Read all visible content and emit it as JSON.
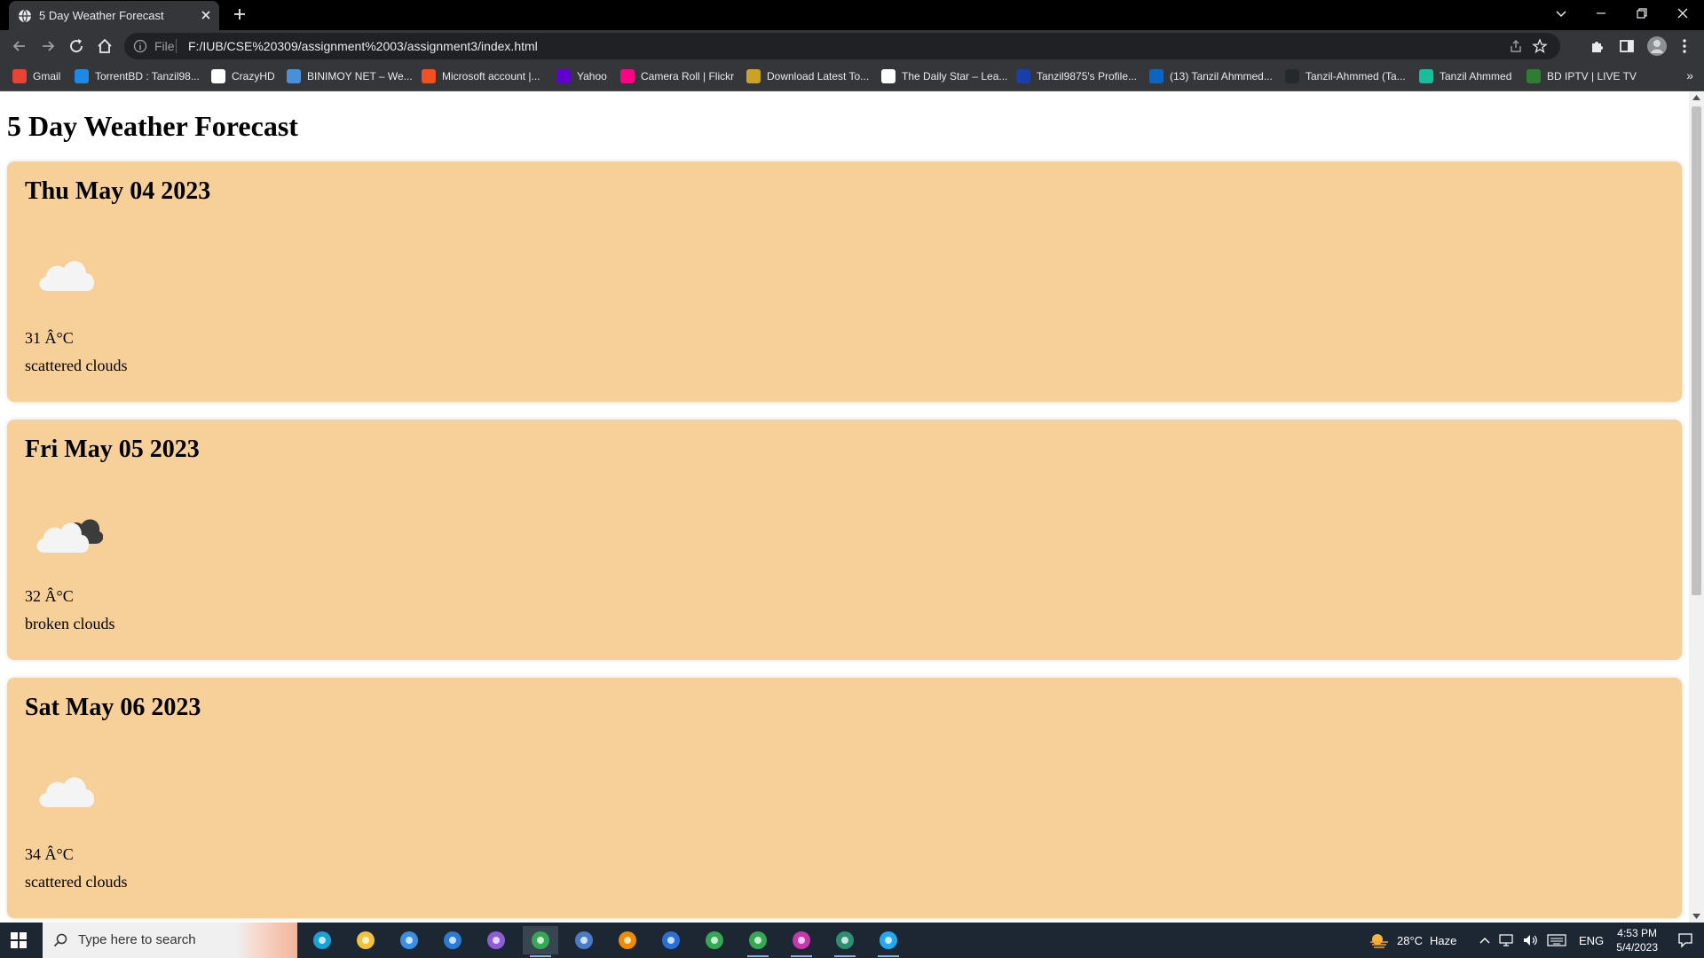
{
  "browser": {
    "tab_title": "5 Day Weather Forecast",
    "omnibox": {
      "scheme_label": "File",
      "url": "F:/IUB/CSE%20309/assignment%2003/assignment3/index.html"
    },
    "bookmarks": [
      {
        "label": "Gmail",
        "icon": "gmail-icon",
        "color": "#ea4335"
      },
      {
        "label": "TorrentBD : Tanzil98...",
        "icon": "torrentbd-icon",
        "color": "#1e88e5"
      },
      {
        "label": "CrazyHD",
        "icon": "crazyhd-icon",
        "color": "#ffffff"
      },
      {
        "label": "BINIMOY NET – We...",
        "icon": "binimoy-icon",
        "color": "#4a90d9"
      },
      {
        "label": "Microsoft account |...",
        "icon": "microsoft-icon",
        "color": "#f25022"
      },
      {
        "label": "Yahoo",
        "icon": "yahoo-icon",
        "color": "#6001d2"
      },
      {
        "label": "Camera Roll | Flickr",
        "icon": "flickr-icon",
        "color": "#ff0084"
      },
      {
        "label": "Download Latest To...",
        "icon": "download-icon",
        "color": "#c9a227"
      },
      {
        "label": "The Daily Star – Lea...",
        "icon": "dailystar-icon",
        "color": "#ffffff"
      },
      {
        "label": "Tanzil9875's Profile...",
        "icon": "star-profile-icon",
        "color": "#1a3fa8"
      },
      {
        "label": "(13) Tanzil Ahmmed...",
        "icon": "linkedin-icon",
        "color": "#0a66c2"
      },
      {
        "label": "Tanzil-Ahmmed (Ta...",
        "icon": "github-icon",
        "color": "#24292e"
      },
      {
        "label": "Tanzil Ahmmed",
        "icon": "replit-icon",
        "color": "#1abc9c"
      },
      {
        "label": "BD IPTV | LIVE TV",
        "icon": "iptv-icon",
        "color": "#2e7d32"
      }
    ],
    "more_bookmarks": "»"
  },
  "page": {
    "title": "5 Day Weather Forecast",
    "background_card_color": "#f7cf98",
    "forecasts": [
      {
        "date": "Thu May 04 2023",
        "icon": "scattered-clouds-icon",
        "temperature": "31 Â°C",
        "description": "scattered clouds"
      },
      {
        "date": "Fri May 05 2023",
        "icon": "broken-clouds-icon",
        "temperature": "32 Â°C",
        "description": "broken clouds"
      },
      {
        "date": "Sat May 06 2023",
        "icon": "scattered-clouds-icon",
        "temperature": "34 Â°C",
        "description": "scattered clouds"
      }
    ]
  },
  "taskbar": {
    "search_placeholder": "Type here to search",
    "apps": [
      "edge-icon",
      "file-explorer-icon",
      "store-icon",
      "mail-icon",
      "visual-studio-icon",
      "chrome-icon",
      "qbittorrent-icon",
      "vlc-icon",
      "notes-icon",
      "chrome-icon",
      "chrome-icon",
      "messenger-icon",
      "app-installer-icon",
      "vscode-icon"
    ],
    "weather": {
      "temp": "28°C",
      "condition": "Haze"
    },
    "language": "ENG",
    "time": "4:53 PM",
    "date": "5/4/2023"
  }
}
